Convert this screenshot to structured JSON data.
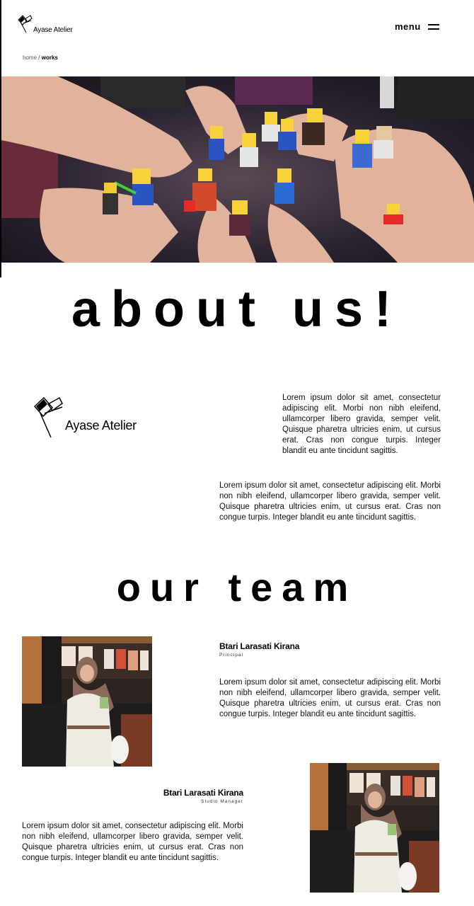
{
  "brand": {
    "name": "Ayase Atelier",
    "logo_icon": "atelier-flag-logo"
  },
  "header": {
    "menu_label": "menu",
    "menu_icon": "hamburger-icon"
  },
  "breadcrumb": {
    "home": "home",
    "separator": "/",
    "current": "works"
  },
  "hero": {
    "image": "hands-holding-lego-minifigures-photo"
  },
  "about": {
    "heading": "about us!",
    "paragraph_1": "Lorem ipsum dolor sit amet, consectetur adipiscing elit. Morbi non nibh eleifend, ullamcorper libero gravida, semper velit. Quisque pharetra ultricies enim, ut cursus erat. Cras non congue turpis. Integer blandit eu ante tincidunt sagittis.",
    "paragraph_2": "Lorem ipsum dolor sit amet, consectetur adipiscing elit. Morbi non nibh eleifend, ullamcorper libero gravida, semper velit. Quisque pharetra ultricies enim, ut cursus erat. Cras non congue turpis. Integer blandit eu ante tincidunt sagittis."
  },
  "team": {
    "heading": "our team",
    "members": [
      {
        "name": "Btari Larasati Kirana",
        "role": "Principal",
        "bio": "Lorem ipsum dolor sit amet, consectetur adipiscing elit. Morbi non nibh eleifend, ullamcorper libero gravida, semper velit. Quisque pharetra ultricies enim, ut cursus erat. Cras non congue turpis. Integer blandit eu ante tincidunt sagittis.",
        "photo": "member-portrait-photo"
      },
      {
        "name": "Btari Larasati Kirana",
        "role": "Studio Manager",
        "bio": "Lorem ipsum dolor sit amet, consectetur adipiscing elit. Morbi non nibh eleifend, ullamcorper libero gravida, semper velit. Quisque pharetra ultricies enim, ut cursus erat. Cras non congue turpis. Integer blandit eu ante tincidunt sagittis.",
        "photo": "member-portrait-photo"
      }
    ]
  }
}
